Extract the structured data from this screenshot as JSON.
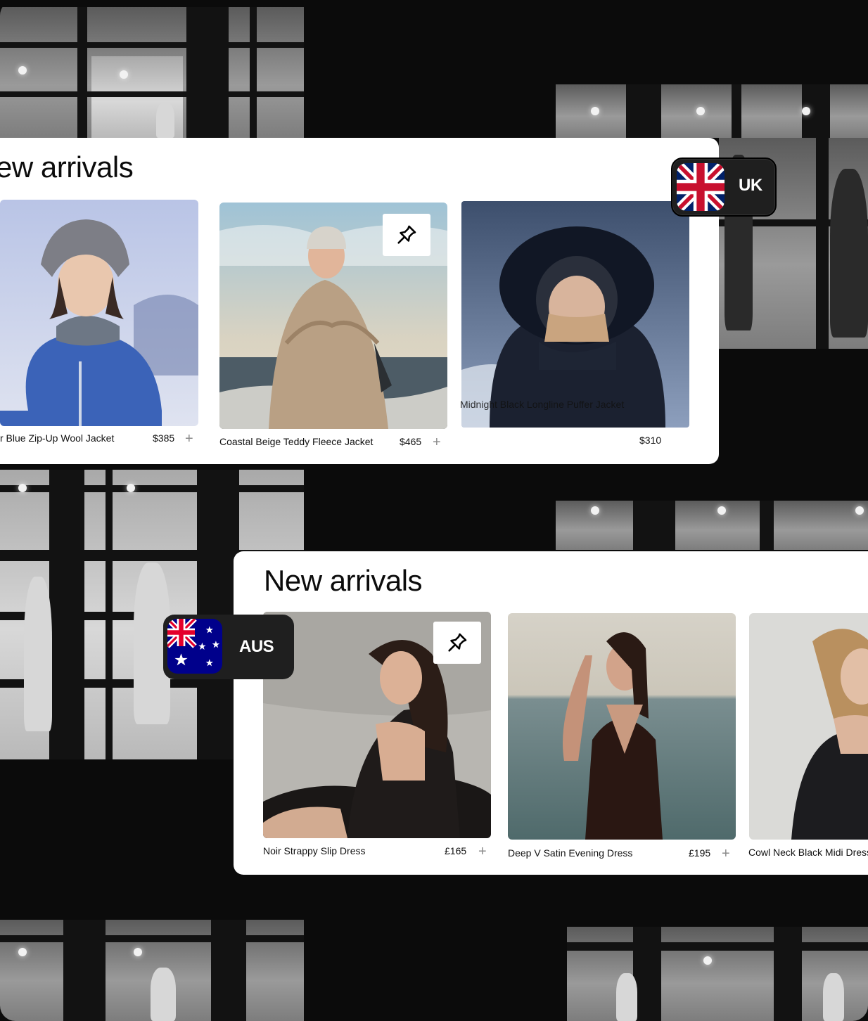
{
  "uk_section": {
    "title": "ew arrivals",
    "region": "UK",
    "products": [
      {
        "name": "r Blue Zip-Up Wool Jacket",
        "price": "$385"
      },
      {
        "name": "Coastal Beige Teddy Fleece Jacket",
        "price": "$465"
      },
      {
        "name": "Midnight Black Longline Puffer Jacket",
        "price": "$310"
      }
    ]
  },
  "aus_section": {
    "title": "New arrivals",
    "region": "AUS",
    "products": [
      {
        "name": "Noir Strappy Slip Dress",
        "price": "£165"
      },
      {
        "name": "Deep V Satin Evening Dress",
        "price": "£195"
      },
      {
        "name": "Cowl Neck Black Midi Dress",
        "price": ""
      }
    ]
  },
  "icons": {
    "pin": "pin-icon",
    "add": "plus-icon"
  },
  "colors": {
    "background": "#0b0b0b",
    "card": "#ffffff",
    "badge": "#1f1f1f",
    "text": "#111111"
  }
}
